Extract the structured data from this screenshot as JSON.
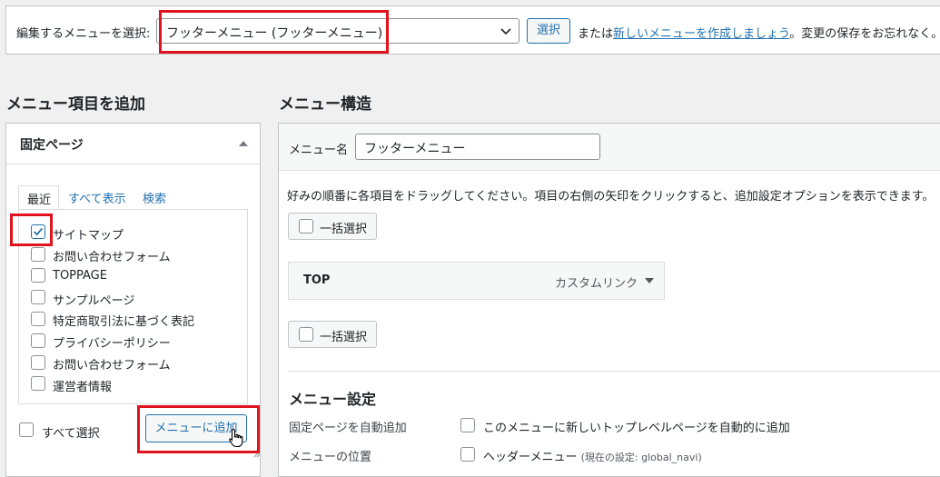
{
  "topbar": {
    "label": "編集するメニューを選択:",
    "selected_menu": "フッターメニュー (フッターメニュー)",
    "select_button": "選択",
    "tail_prefix": "または",
    "create_link": "新しいメニューを作成しましょう",
    "tail_suffix": "。変更の保存をお忘れなく。"
  },
  "left": {
    "heading": "メニュー項目を追加",
    "panel_title": "固定ページ",
    "tabs": [
      "最近",
      "すべて表示",
      "検索"
    ],
    "pages": [
      {
        "label": "サイトマップ",
        "checked": true
      },
      {
        "label": "お問い合わせフォーム",
        "checked": false
      },
      {
        "label": "TOPPAGE",
        "checked": false
      },
      {
        "label": "サンプルページ",
        "checked": false
      },
      {
        "label": "特定商取引法に基づく表記",
        "checked": false
      },
      {
        "label": "プライバシーポリシー",
        "checked": false
      },
      {
        "label": "お問い合わせフォーム",
        "checked": false
      },
      {
        "label": "運営者情報",
        "checked": false
      }
    ],
    "select_all": "すべて選択",
    "add_button": "メニューに追加"
  },
  "right": {
    "heading": "メニュー構造",
    "menu_name_label": "メニュー名",
    "menu_name_value": "フッターメニュー",
    "instructions": "好みの順番に各項目をドラッグしてください。項目の右側の矢印をクリックすると、追加設定オプションを表示できます。",
    "bulk_select": "一括選択",
    "menu_items": [
      {
        "title": "TOP",
        "type": "カスタムリンク"
      }
    ],
    "settings_title": "メニュー設定",
    "auto_add_label": "固定ページを自動追加",
    "auto_add_text": "このメニューに新しいトップレベルページを自動的に追加",
    "location_label": "メニューの位置",
    "location_text": "ヘッダーメニュー",
    "location_note": "(現在の設定: global_navi)"
  },
  "colors": {
    "accent": "#2271b1",
    "highlight": "#e0121e"
  }
}
